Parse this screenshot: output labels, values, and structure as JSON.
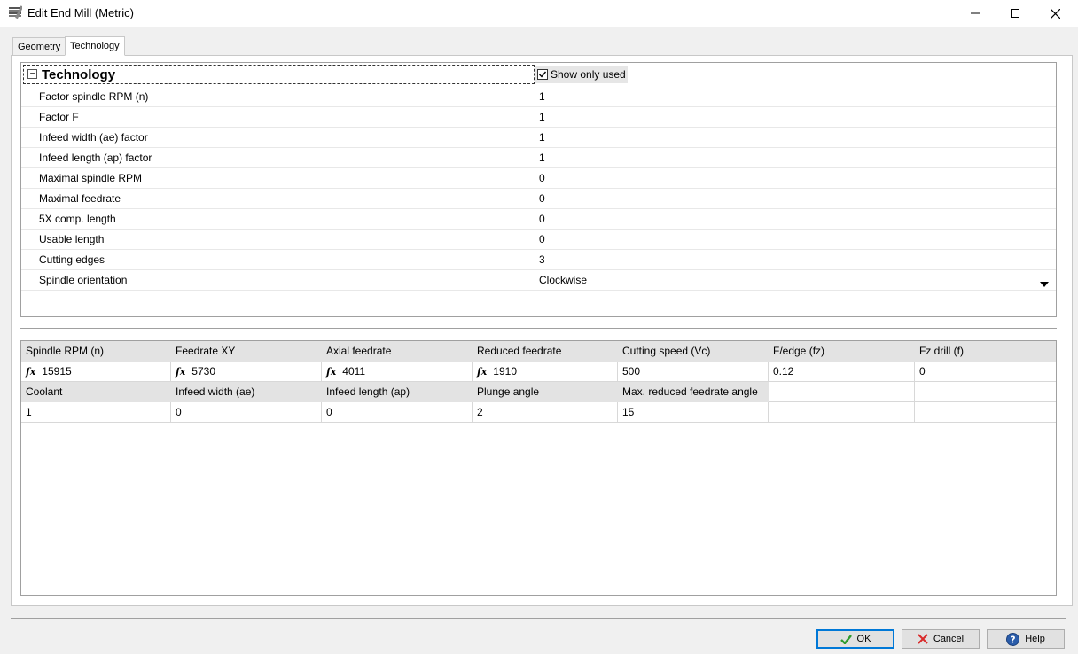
{
  "window": {
    "title": "Edit End Mill (Metric)",
    "minimize_label": "—",
    "maximize_label": "☐",
    "close_label": "✕"
  },
  "tabs": [
    {
      "label": "Geometry"
    },
    {
      "label": "Technology"
    }
  ],
  "technology": {
    "section_title": "Technology",
    "collapse_label": "−",
    "show_only_used_label": "Show only used",
    "show_only_used": true,
    "properties": [
      {
        "label": "Factor spindle RPM (n)",
        "value": "1"
      },
      {
        "label": "Factor F",
        "value": "1"
      },
      {
        "label": "Infeed width (ae) factor",
        "value": "1"
      },
      {
        "label": "Infeed length (ap) factor",
        "value": "1"
      },
      {
        "label": "Maximal spindle RPM",
        "value": "0"
      },
      {
        "label": "Maximal feedrate",
        "value": "0"
      },
      {
        "label": "5X comp. length",
        "value": "0"
      },
      {
        "label": "Usable length",
        "value": "0"
      },
      {
        "label": "Cutting edges",
        "value": "3"
      },
      {
        "label": "Spindle orientation",
        "value": "Clockwise"
      }
    ]
  },
  "params_table": {
    "row1_headers": [
      "Spindle RPM (n)",
      "Feedrate XY",
      "Axial feedrate",
      "Reduced feedrate",
      "Cutting speed (Vc)",
      "F/edge (fz)",
      "Fz drill (f)"
    ],
    "row1_values": [
      "15915",
      "5730",
      "4011",
      "1910",
      "500",
      "0.12",
      "0"
    ],
    "fx_label": "fx",
    "row2_headers": [
      "Coolant",
      "Infeed width (ae)",
      "Infeed length (ap)",
      "Plunge angle",
      "Max. reduced feedrate angle"
    ],
    "row2_values": [
      "1",
      "0",
      "0",
      "2",
      "15"
    ]
  },
  "buttons": {
    "ok": "OK",
    "cancel": "Cancel",
    "help": "Help"
  },
  "colors": {
    "ok_check": "#2e9b2e",
    "cancel_x": "#d92b2b",
    "help_blue": "#2a5caa",
    "accent": "#0078d7"
  }
}
